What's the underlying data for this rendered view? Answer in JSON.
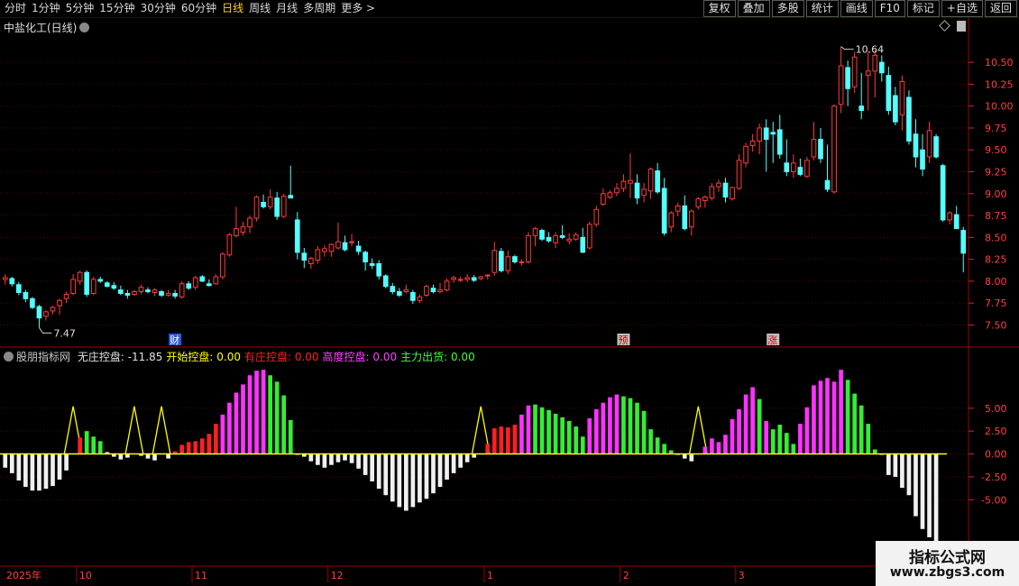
{
  "toolbar": {
    "periods": [
      "分时",
      "1分钟",
      "5分钟",
      "15分钟",
      "30分钟",
      "60分钟",
      "日线",
      "周线",
      "月线",
      "多周期",
      "更多 >"
    ],
    "active_period": "日线",
    "actions": [
      "复权",
      "叠加",
      "多股",
      "统计",
      "画线",
      "F10",
      "标记",
      "+自选",
      "返回"
    ]
  },
  "stock_title": "中盐化工(日线)",
  "indicator": {
    "name": "股朋指标网",
    "items": [
      {
        "label": "无庄控盘: -11.85",
        "color": "#e0e0e0"
      },
      {
        "label": "开始控盘: 0.00",
        "color": "#ffff00"
      },
      {
        "label": "有庄控盘: 0.00",
        "color": "#ff2020"
      },
      {
        "label": "高度控盘: 0.00",
        "color": "#ff40ff"
      },
      {
        "label": "主力出货: 0.00",
        "color": "#40ff40"
      }
    ]
  },
  "price_axis": [
    "10.50",
    "10.25",
    "10.00",
    "9.75",
    "9.50",
    "9.25",
    "9.00",
    "8.75",
    "8.50",
    "8.25",
    "8.00",
    "7.75",
    "7.50"
  ],
  "indicator_axis": [
    "5.00",
    "2.50",
    "0.00",
    "-2.50",
    "-5.00"
  ],
  "annotations": {
    "high": "10.64",
    "low": "7.47"
  },
  "event_markers": [
    "财",
    "预",
    "涨"
  ],
  "date_axis": [
    "2025年",
    "10",
    "11",
    "12",
    "1",
    "2",
    "3"
  ],
  "watermark": {
    "title": "指标公式网",
    "url": "www.zbgs3.com"
  },
  "colors": {
    "up": "#ff3b3b",
    "down": "#54ffff",
    "grid": "#5a0000",
    "magenta": "#ff33ff",
    "green": "#33ee33",
    "red": "#ff2020",
    "white": "#f0f0f0",
    "yellow": "#ffff00"
  },
  "chart_data": {
    "type": "candlestick",
    "ohlc": [
      [
        8.02,
        8.08,
        7.96,
        8.04
      ],
      [
        8.03,
        8.05,
        7.94,
        7.97
      ],
      [
        7.96,
        7.99,
        7.84,
        7.87
      ],
      [
        7.87,
        7.9,
        7.76,
        7.8
      ],
      [
        7.8,
        7.82,
        7.68,
        7.7
      ],
      [
        7.71,
        7.73,
        7.47,
        7.58
      ],
      [
        7.6,
        7.67,
        7.55,
        7.65
      ],
      [
        7.66,
        7.72,
        7.62,
        7.7
      ],
      [
        7.72,
        7.8,
        7.62,
        7.78
      ],
      [
        7.8,
        7.88,
        7.75,
        7.85
      ],
      [
        7.86,
        8.08,
        7.84,
        8.02
      ],
      [
        8.0,
        8.12,
        7.96,
        8.1
      ],
      [
        8.1,
        8.12,
        7.82,
        7.85
      ],
      [
        7.86,
        8.05,
        7.84,
        8.02
      ],
      [
        8.02,
        8.05,
        7.98,
        8.0
      ],
      [
        7.98,
        8.0,
        7.93,
        7.94
      ],
      [
        7.95,
        7.99,
        7.9,
        7.92
      ],
      [
        7.9,
        7.95,
        7.84,
        7.86
      ],
      [
        7.86,
        7.9,
        7.8,
        7.84
      ],
      [
        7.85,
        7.9,
        7.83,
        7.88
      ],
      [
        7.88,
        7.96,
        7.85,
        7.93
      ],
      [
        7.9,
        7.93,
        7.86,
        7.88
      ],
      [
        7.87,
        7.92,
        7.83,
        7.9
      ],
      [
        7.88,
        7.9,
        7.82,
        7.84
      ],
      [
        7.84,
        7.9,
        7.82,
        7.86
      ],
      [
        7.86,
        7.9,
        7.8,
        7.83
      ],
      [
        7.82,
        8.0,
        7.8,
        7.97
      ],
      [
        7.97,
        8.0,
        7.9,
        7.92
      ],
      [
        7.93,
        8.06,
        7.9,
        8.04
      ],
      [
        8.05,
        8.07,
        7.99,
        8.0
      ],
      [
        7.97,
        8.02,
        7.94,
        7.95
      ],
      [
        7.97,
        8.08,
        7.96,
        8.05
      ],
      [
        8.05,
        8.33,
        8.02,
        8.31
      ],
      [
        8.3,
        8.55,
        8.28,
        8.53
      ],
      [
        8.52,
        8.85,
        8.5,
        8.6
      ],
      [
        8.56,
        8.68,
        8.52,
        8.62
      ],
      [
        8.62,
        8.75,
        8.55,
        8.72
      ],
      [
        8.72,
        8.98,
        8.68,
        8.96
      ],
      [
        8.9,
        8.99,
        8.83,
        8.85
      ],
      [
        8.85,
        9.05,
        8.82,
        8.96
      ],
      [
        8.95,
        9.02,
        8.7,
        8.74
      ],
      [
        8.74,
        9.0,
        8.72,
        8.97
      ],
      [
        8.98,
        9.32,
        8.95,
        8.95
      ],
      [
        8.7,
        8.79,
        8.25,
        8.33
      ],
      [
        8.32,
        8.38,
        8.15,
        8.24
      ],
      [
        8.2,
        8.28,
        8.14,
        8.26
      ],
      [
        8.24,
        8.4,
        8.2,
        8.36
      ],
      [
        8.34,
        8.41,
        8.28,
        8.37
      ],
      [
        8.34,
        8.43,
        8.28,
        8.42
      ],
      [
        8.38,
        8.67,
        8.36,
        8.45
      ],
      [
        8.44,
        8.52,
        8.34,
        8.36
      ],
      [
        8.44,
        8.54,
        8.4,
        8.45
      ],
      [
        8.4,
        8.46,
        8.3,
        8.34
      ],
      [
        8.33,
        8.35,
        8.12,
        8.22
      ],
      [
        8.2,
        8.26,
        8.14,
        8.18
      ],
      [
        8.2,
        8.24,
        8.02,
        8.06
      ],
      [
        8.06,
        8.08,
        7.92,
        7.94
      ],
      [
        7.94,
        7.98,
        7.85,
        7.88
      ],
      [
        7.88,
        7.92,
        7.82,
        7.84
      ],
      [
        7.88,
        7.96,
        7.86,
        7.9
      ],
      [
        7.87,
        7.9,
        7.74,
        7.78
      ],
      [
        7.78,
        7.85,
        7.75,
        7.82
      ],
      [
        7.84,
        7.96,
        7.82,
        7.94
      ],
      [
        7.92,
        7.96,
        7.86,
        7.88
      ],
      [
        7.88,
        7.98,
        7.86,
        7.9
      ],
      [
        7.9,
        8.03,
        7.88,
        8.0
      ],
      [
        8.02,
        8.06,
        7.98,
        8.04
      ],
      [
        8.02,
        8.05,
        7.99,
        8.02
      ],
      [
        8.02,
        8.08,
        7.99,
        8.04
      ],
      [
        8.04,
        8.07,
        7.99,
        8.01
      ],
      [
        8.03,
        8.06,
        8.01,
        8.05
      ],
      [
        8.06,
        8.08,
        8.02,
        8.07
      ],
      [
        8.1,
        8.45,
        8.06,
        8.35
      ],
      [
        8.34,
        8.38,
        8.1,
        8.12
      ],
      [
        8.12,
        8.35,
        8.08,
        8.28
      ],
      [
        8.28,
        8.3,
        8.2,
        8.22
      ],
      [
        8.22,
        8.25,
        8.18,
        8.22
      ],
      [
        8.22,
        8.56,
        8.2,
        8.52
      ],
      [
        8.52,
        8.62,
        8.4,
        8.6
      ],
      [
        8.58,
        8.6,
        8.46,
        8.48
      ],
      [
        8.5,
        8.56,
        8.44,
        8.46
      ],
      [
        8.44,
        8.56,
        8.38,
        8.52
      ],
      [
        8.52,
        8.64,
        8.48,
        8.5
      ],
      [
        8.46,
        8.55,
        8.42,
        8.48
      ],
      [
        8.48,
        8.56,
        8.46,
        8.53
      ],
      [
        8.5,
        8.61,
        8.32,
        8.33
      ],
      [
        8.38,
        8.68,
        8.36,
        8.65
      ],
      [
        8.65,
        8.86,
        8.62,
        8.82
      ],
      [
        8.88,
        9.06,
        8.86,
        9.0
      ],
      [
        8.96,
        9.04,
        8.94,
        9.01
      ],
      [
        9.01,
        9.12,
        8.97,
        9.06
      ],
      [
        9.06,
        9.22,
        9.02,
        9.14
      ],
      [
        9.12,
        9.46,
        8.95,
        9.15
      ],
      [
        9.12,
        9.22,
        8.88,
        8.95
      ],
      [
        8.98,
        9.12,
        8.9,
        9.05
      ],
      [
        9.03,
        9.3,
        8.94,
        9.28
      ],
      [
        9.26,
        9.35,
        9.0,
        9.02
      ],
      [
        9.06,
        9.18,
        8.52,
        8.55
      ],
      [
        8.62,
        8.8,
        8.56,
        8.78
      ],
      [
        8.8,
        8.9,
        8.74,
        8.86
      ],
      [
        8.86,
        8.98,
        8.58,
        8.6
      ],
      [
        8.62,
        8.82,
        8.52,
        8.8
      ],
      [
        8.85,
        8.96,
        8.82,
        8.94
      ],
      [
        8.92,
        8.98,
        8.84,
        8.96
      ],
      [
        8.95,
        9.12,
        8.92,
        9.08
      ],
      [
        9.08,
        9.16,
        9.02,
        9.12
      ],
      [
        9.12,
        9.18,
        8.9,
        8.96
      ],
      [
        8.94,
        9.08,
        8.92,
        9.07
      ],
      [
        9.06,
        9.45,
        9.04,
        9.38
      ],
      [
        9.35,
        9.58,
        9.3,
        9.54
      ],
      [
        9.55,
        9.68,
        9.48,
        9.6
      ],
      [
        9.6,
        9.8,
        9.45,
        9.75
      ],
      [
        9.75,
        9.85,
        9.25,
        9.62
      ],
      [
        9.7,
        9.82,
        9.35,
        9.68
      ],
      [
        9.73,
        9.9,
        9.4,
        9.45
      ],
      [
        9.35,
        9.62,
        9.2,
        9.25
      ],
      [
        9.25,
        9.45,
        9.18,
        9.35
      ],
      [
        9.3,
        9.4,
        9.2,
        9.22
      ],
      [
        9.2,
        9.42,
        9.18,
        9.38
      ],
      [
        9.42,
        9.82,
        9.38,
        9.62
      ],
      [
        9.62,
        9.75,
        9.35,
        9.4
      ],
      [
        9.15,
        9.56,
        9.02,
        9.05
      ],
      [
        9.02,
        10.02,
        9.0,
        10.0
      ],
      [
        10.02,
        10.68,
        9.92,
        10.46
      ],
      [
        10.44,
        10.52,
        10.0,
        10.2
      ],
      [
        10.22,
        10.62,
        10.15,
        10.56
      ],
      [
        10.0,
        10.38,
        9.85,
        9.95
      ],
      [
        10.35,
        10.63,
        9.95,
        10.4
      ],
      [
        10.4,
        10.64,
        10.1,
        10.58
      ],
      [
        10.5,
        10.58,
        10.28,
        10.38
      ],
      [
        10.35,
        10.45,
        9.9,
        9.95
      ],
      [
        10.12,
        10.22,
        9.78,
        9.82
      ],
      [
        9.9,
        10.35,
        9.72,
        10.28
      ],
      [
        10.1,
        10.18,
        9.56,
        9.6
      ],
      [
        9.68,
        9.85,
        9.3,
        9.42
      ],
      [
        9.5,
        9.68,
        9.2,
        9.28
      ],
      [
        9.42,
        9.82,
        9.35,
        9.72
      ],
      [
        9.65,
        9.68,
        9.4,
        9.42
      ],
      [
        9.32,
        9.34,
        8.68,
        8.7
      ],
      [
        8.7,
        8.8,
        8.65,
        8.78
      ],
      [
        8.76,
        8.86,
        8.6,
        8.6
      ],
      [
        8.58,
        8.62,
        8.1,
        8.32
      ]
    ],
    "indicator_values": [
      -1.5,
      -2.1,
      -2.9,
      -3.6,
      -4.0,
      -4.0,
      -3.8,
      -3.5,
      -2.8,
      -1.8,
      5.2,
      1.8,
      2.5,
      1.9,
      1.4,
      0.2,
      -0.3,
      -0.6,
      -0.4,
      5.2,
      -0.2,
      -0.5,
      -0.7,
      5.2,
      -0.5,
      0.3,
      1.0,
      1.3,
      1.4,
      1.7,
      2.2,
      3.3,
      4.3,
      5.6,
      6.7,
      7.6,
      8.6,
      9.1,
      9.2,
      8.6,
      7.9,
      6.4,
      3.7,
      0,
      -0.3,
      -0.8,
      -1.2,
      -1.5,
      -1.2,
      -0.9,
      -0.7,
      -1.0,
      -1.6,
      -2.3,
      -3.0,
      -3.8,
      -4.5,
      -5.2,
      -5.8,
      -6.2,
      -5.8,
      -5.3,
      -4.9,
      -4.3,
      -3.6,
      -2.8,
      -2.1,
      -1.5,
      -0.9,
      -0.4,
      5.2,
      1.1,
      2.8,
      3.0,
      2.9,
      3.2,
      4.3,
      5.3,
      5.4,
      5.1,
      4.8,
      4.4,
      4.0,
      3.6,
      3.0,
      1.9,
      3.9,
      4.9,
      5.6,
      6.2,
      6.5,
      6.3,
      6.1,
      5.6,
      4.7,
      2.7,
      1.8,
      1.1,
      0.4,
      0,
      -0.5,
      -0.8,
      5.2,
      0.8,
      1.7,
      1.3,
      2.1,
      3.8,
      4.9,
      6.5,
      7.3,
      6.0,
      3.6,
      2.7,
      3.2,
      2.3,
      1.1,
      3.3,
      5.1,
      7.5,
      8.0,
      8.3,
      7.9,
      9.2,
      8.1,
      6.6,
      5.3,
      3.3,
      0.5,
      0,
      -2.3,
      -2.5,
      -3.7,
      -4.5,
      -6.8,
      -8.2,
      -9.1,
      -10.0
    ],
    "indicator_series_colors": [
      "white",
      "white",
      "white",
      "white",
      "white",
      "white",
      "white",
      "white",
      "white",
      "white",
      "yellow",
      "red",
      "green",
      "green",
      "green",
      "white",
      "white",
      "white",
      "white",
      "yellow",
      "white",
      "white",
      "white",
      "yellow",
      "white",
      "red",
      "red",
      "red",
      "red",
      "red",
      "red",
      "red",
      "magenta",
      "magenta",
      "magenta",
      "magenta",
      "magenta",
      "magenta",
      "magenta",
      "green",
      "green",
      "green",
      "green",
      "white",
      "white",
      "white",
      "white",
      "white",
      "white",
      "white",
      "white",
      "white",
      "white",
      "white",
      "white",
      "white",
      "white",
      "white",
      "white",
      "white",
      "white",
      "white",
      "white",
      "white",
      "white",
      "white",
      "white",
      "white",
      "white",
      "white",
      "yellow",
      "red",
      "red",
      "red",
      "red",
      "red",
      "magenta",
      "magenta",
      "green",
      "green",
      "green",
      "green",
      "green",
      "green",
      "green",
      "green",
      "magenta",
      "magenta",
      "magenta",
      "magenta",
      "magenta",
      "green",
      "green",
      "green",
      "green",
      "green",
      "green",
      "green",
      "green",
      "white",
      "white",
      "white",
      "yellow",
      "magenta",
      "magenta",
      "magenta",
      "magenta",
      "magenta",
      "magenta",
      "magenta",
      "magenta",
      "green",
      "magenta",
      "green",
      "green",
      "green",
      "green",
      "magenta",
      "magenta",
      "magenta",
      "magenta",
      "magenta",
      "magenta",
      "magenta",
      "green",
      "green",
      "green",
      "green",
      "green",
      "white",
      "white",
      "white",
      "white",
      "white",
      "white",
      "white",
      "white",
      "white"
    ],
    "price_range": [
      7.35,
      10.8
    ],
    "indicator_range": [
      -9.5,
      10.2
    ]
  }
}
